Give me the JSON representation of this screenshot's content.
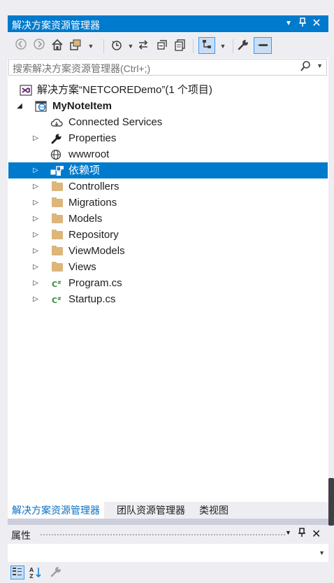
{
  "window": {
    "title": "解决方案资源管理器",
    "controls": [
      "dropdown-icon",
      "pin-icon",
      "close-icon"
    ]
  },
  "toolbar": {
    "buttons": [
      "back-icon",
      "forward-icon",
      "home-icon",
      "switch-views-icon",
      "history-icon",
      "sync-icon",
      "collapse-all-icon",
      "show-all-files-icon",
      "preview-icon",
      "properties-wrench-icon",
      "pin-selected-icon"
    ]
  },
  "search": {
    "placeholder": "搜索解决方案资源管理器(Ctrl+;)"
  },
  "tree": {
    "solution": "解决方案“NETCOREDemo”(1 个项目)",
    "project": "MyNoteItem",
    "items": [
      {
        "label": "Connected Services",
        "icon": "cloud-icon",
        "expandable": false
      },
      {
        "label": "Properties",
        "icon": "wrench-icon",
        "expandable": true
      },
      {
        "label": "wwwroot",
        "icon": "globe-icon",
        "expandable": false
      },
      {
        "label": "依赖项",
        "icon": "dependencies-icon",
        "expandable": true,
        "selected": true
      },
      {
        "label": "Controllers",
        "icon": "folder-icon",
        "expandable": true
      },
      {
        "label": "Migrations",
        "icon": "folder-icon",
        "expandable": true
      },
      {
        "label": "Models",
        "icon": "folder-icon",
        "expandable": true
      },
      {
        "label": "Repository",
        "icon": "folder-icon",
        "expandable": true
      },
      {
        "label": "ViewModels",
        "icon": "folder-icon",
        "expandable": true
      },
      {
        "label": "Views",
        "icon": "folder-icon",
        "expandable": true
      },
      {
        "label": "Program.cs",
        "icon": "csharp-file-icon",
        "expandable": true
      },
      {
        "label": "Startup.cs",
        "icon": "csharp-file-icon",
        "expandable": true
      }
    ]
  },
  "bottom_tabs": [
    {
      "label": "解决方案资源管理器",
      "active": true
    },
    {
      "label": "团队资源管理器",
      "active": false
    },
    {
      "label": "类视图",
      "active": false
    }
  ],
  "properties": {
    "title": "属性"
  },
  "colors": {
    "accent": "#007acc",
    "folder": "#dcb67a",
    "csharp": "#388a34",
    "vs_purple": "#68217a"
  }
}
